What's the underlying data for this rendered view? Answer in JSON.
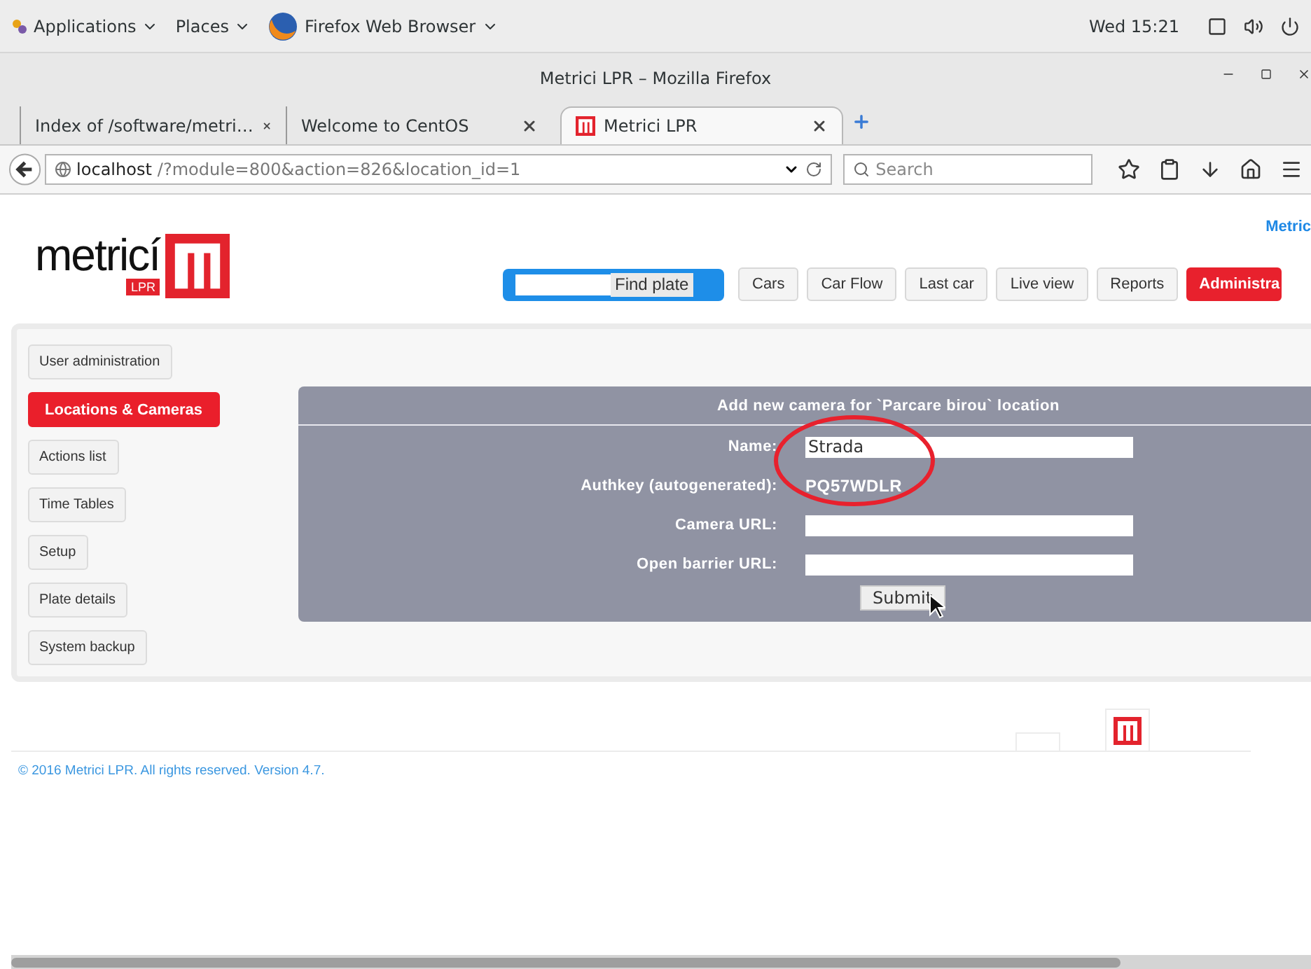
{
  "desktop_bar": {
    "menus": [
      {
        "label": "Applications"
      },
      {
        "label": "Places"
      },
      {
        "label": "Firefox Web Browser"
      }
    ],
    "clock": "Wed 15:21"
  },
  "window": {
    "title": "Metrici LPR – Mozilla Firefox"
  },
  "tabs": [
    {
      "label": "Index of /software/metri…",
      "selected": false
    },
    {
      "label": "Welcome to CentOS",
      "selected": false
    },
    {
      "label": "Metrici LPR",
      "selected": true
    }
  ],
  "address_bar": {
    "host": "localhost",
    "path": "/?module=800&action=826&location_id=1"
  },
  "search": {
    "placeholder": "Search"
  },
  "page": {
    "logo": {
      "name": "metricí",
      "tag": "LPR"
    },
    "top_link": "Metric",
    "find_plate": {
      "button": "Find plate"
    },
    "nav": [
      {
        "label": "Cars",
        "selected": false
      },
      {
        "label": "Car Flow",
        "selected": false
      },
      {
        "label": "Last car",
        "selected": false
      },
      {
        "label": "Live view",
        "selected": false
      },
      {
        "label": "Reports",
        "selected": false
      },
      {
        "label": "Administra",
        "selected": true
      }
    ],
    "sidebar": [
      {
        "label": "User administration",
        "selected": false
      },
      {
        "label": "Locations & Cameras",
        "selected": true
      },
      {
        "label": "Actions list",
        "selected": false
      },
      {
        "label": "Time Tables",
        "selected": false
      },
      {
        "label": "Setup",
        "selected": false
      },
      {
        "label": "Plate details",
        "selected": false
      },
      {
        "label": "System backup",
        "selected": false
      }
    ],
    "form": {
      "title": "Add new camera for `Parcare birou` location",
      "fields": [
        {
          "kind": "input",
          "label": "Name:",
          "value": "Strada"
        },
        {
          "kind": "static",
          "label": "Authkey (autogenerated):",
          "value": "PQ57WDLR"
        },
        {
          "kind": "input",
          "label": "Camera URL:"
        },
        {
          "kind": "input",
          "label": "Open barrier URL:"
        }
      ],
      "submit": "Submit"
    },
    "footer": {
      "copyright": "© 2016 Metrici LPR. All rights reserved. Version 4.7."
    }
  }
}
